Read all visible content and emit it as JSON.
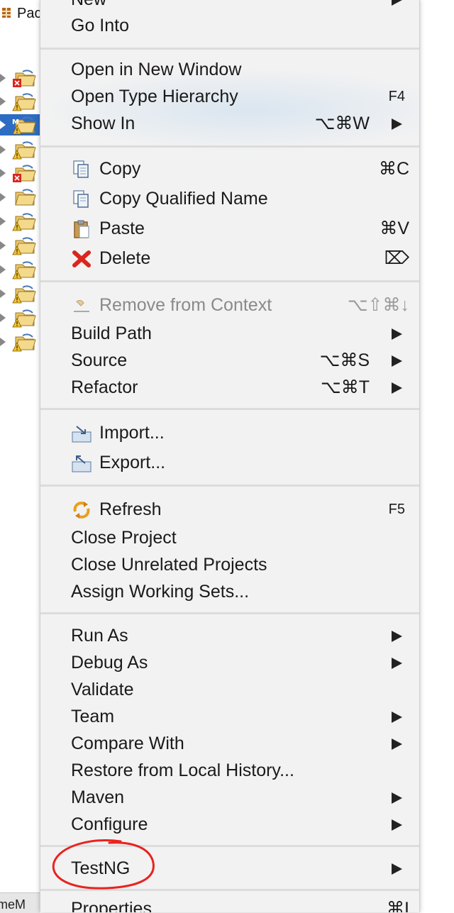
{
  "explorer": {
    "header_text": "Pac",
    "bottom_tab": "meM",
    "rows": [
      {
        "badge": "error",
        "selected": false
      },
      {
        "badge": "warning",
        "selected": false
      },
      {
        "badge": "maven-warning",
        "selected": true
      },
      {
        "badge": "warning",
        "selected": false
      },
      {
        "badge": "error",
        "selected": false
      },
      {
        "badge": "none",
        "selected": false
      },
      {
        "badge": "warning",
        "selected": false
      },
      {
        "badge": "warning",
        "selected": false
      },
      {
        "badge": "warning",
        "selected": false
      },
      {
        "badge": "warning",
        "selected": false
      },
      {
        "badge": "warning",
        "selected": false
      },
      {
        "badge": "warning",
        "selected": false
      }
    ]
  },
  "menu": {
    "new": {
      "label": "New"
    },
    "go_into": {
      "label": "Go Into"
    },
    "open_new_window": {
      "label": "Open in New Window"
    },
    "open_type_hierarchy": {
      "label": "Open Type Hierarchy",
      "shortcut": "F4"
    },
    "show_in": {
      "label": "Show In",
      "shortcut": "⌥⌘W"
    },
    "copy": {
      "label": "Copy",
      "shortcut": "⌘C",
      "icon": "copy-icon"
    },
    "copy_qualified": {
      "label": "Copy Qualified Name",
      "icon": "copy-qualified-icon"
    },
    "paste": {
      "label": "Paste",
      "shortcut": "⌘V",
      "icon": "paste-icon"
    },
    "delete": {
      "label": "Delete",
      "shortcut": "⌦",
      "icon": "delete-icon"
    },
    "remove_context": {
      "label": "Remove from Context",
      "shortcut": "⌥⇧⌘↓",
      "icon": "remove-context-icon"
    },
    "build_path": {
      "label": "Build Path"
    },
    "source": {
      "label": "Source",
      "shortcut": "⌥⌘S"
    },
    "refactor": {
      "label": "Refactor",
      "shortcut": "⌥⌘T"
    },
    "import": {
      "label": "Import...",
      "icon": "import-icon"
    },
    "export": {
      "label": "Export...",
      "icon": "export-icon"
    },
    "refresh": {
      "label": "Refresh",
      "shortcut": "F5",
      "icon": "refresh-icon"
    },
    "close_project": {
      "label": "Close Project"
    },
    "close_unrelated": {
      "label": "Close Unrelated Projects"
    },
    "assign_working_sets": {
      "label": "Assign Working Sets..."
    },
    "run_as": {
      "label": "Run As"
    },
    "debug_as": {
      "label": "Debug As"
    },
    "validate": {
      "label": "Validate"
    },
    "team": {
      "label": "Team"
    },
    "compare_with": {
      "label": "Compare With"
    },
    "restore_local_history": {
      "label": "Restore from Local History..."
    },
    "maven": {
      "label": "Maven"
    },
    "configure": {
      "label": "Configure"
    },
    "testng": {
      "label": "TestNG"
    },
    "properties": {
      "label": "Properties",
      "shortcut": "⌘I"
    }
  },
  "colors": {
    "menu_bg": "#f2f2f2",
    "selection": "#2d6cc2",
    "annotation": "#e8231f"
  }
}
